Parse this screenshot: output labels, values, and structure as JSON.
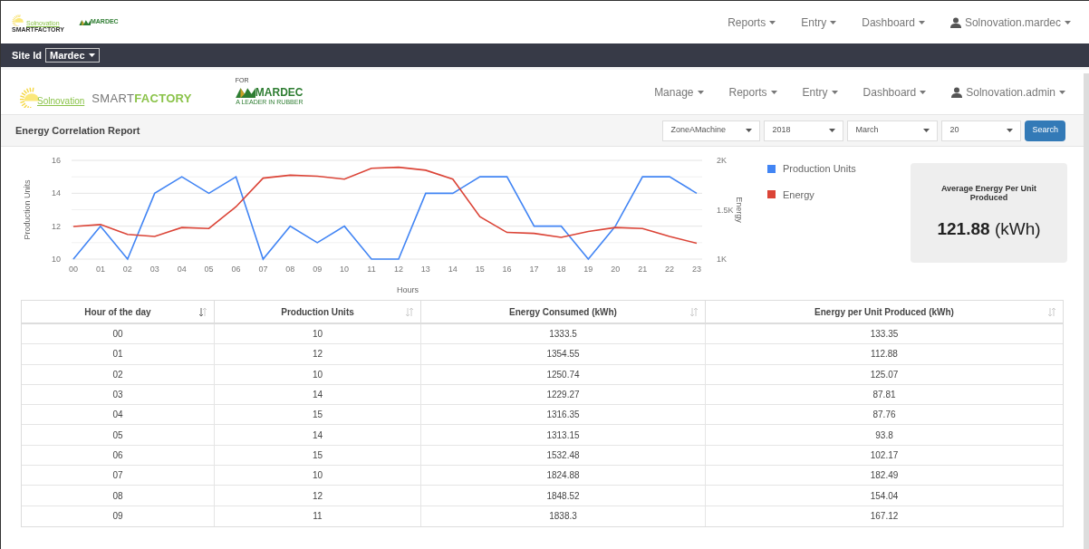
{
  "outer_header": {
    "logo": {
      "brand": "Solnovation",
      "product": "SMARTFACTORY"
    },
    "partner_logo": {
      "name": "MARDEC"
    },
    "nav": [
      {
        "label": "Reports"
      },
      {
        "label": "Entry"
      },
      {
        "label": "Dashboard"
      }
    ],
    "user": "Solnovation.mardec"
  },
  "site_bar": {
    "label": "Site Id",
    "value": "Mardec"
  },
  "app_header": {
    "logo": {
      "brand": "Solnovation",
      "product_a": "SMART",
      "product_b": "FACTORY"
    },
    "partner_logo": {
      "for": "FOR",
      "name": "MARDEC",
      "tagline": "A LEADER IN RUBBER"
    },
    "nav": [
      {
        "label": "Manage"
      },
      {
        "label": "Reports"
      },
      {
        "label": "Entry"
      },
      {
        "label": "Dashboard"
      }
    ],
    "user": "Solnovation.admin"
  },
  "report_bar": {
    "title": "Energy Correlation Report",
    "filters": [
      {
        "value": "ZoneAMachine"
      },
      {
        "value": "2018"
      },
      {
        "value": "March"
      },
      {
        "value": "20"
      }
    ],
    "button": "Search"
  },
  "chart": {
    "chart_data": {
      "type": "line",
      "legend": "right",
      "xlabel": "Hours",
      "ylabel": "Production Units",
      "y2label": "Energy",
      "categories": [
        "00",
        "01",
        "02",
        "03",
        "04",
        "05",
        "06",
        "07",
        "08",
        "09",
        "10",
        "11",
        "12",
        "13",
        "14",
        "15",
        "16",
        "17",
        "18",
        "19",
        "20",
        "21",
        "22",
        "23"
      ],
      "ylim": [
        10,
        16
      ],
      "yticks": [
        10,
        12,
        14,
        16
      ],
      "y2lim": [
        1000,
        2000
      ],
      "y2ticks": [
        {
          "value": 1000,
          "label": "1K"
        },
        {
          "value": 1500,
          "label": "1.5K"
        },
        {
          "value": 2000,
          "label": "2K"
        }
      ],
      "series": [
        {
          "name": "Production Units",
          "color": "#4285f4",
          "values": [
            10,
            12,
            10,
            14,
            15,
            14,
            15,
            10,
            12,
            11,
            12,
            10,
            10,
            14,
            14,
            15,
            15,
            12,
            12,
            10,
            12,
            15,
            15,
            14
          ]
        },
        {
          "name": "Energy",
          "color": "#db4437",
          "axis": "y2",
          "values": [
            1330,
            1350,
            1250,
            1230,
            1320,
            1310,
            1530,
            1820,
            1850,
            1840,
            1810,
            1920,
            1930,
            1900,
            1810,
            1430,
            1270,
            1260,
            1220,
            1280,
            1320,
            1310,
            1230,
            1160
          ]
        }
      ]
    }
  },
  "summary": {
    "title": "Average Energy Per Unit Produced",
    "value": "121.88",
    "unit": "(kWh)"
  },
  "table": {
    "columns": [
      {
        "label": "Hour of the day",
        "sorted": true
      },
      {
        "label": "Production Units",
        "sorted": false
      },
      {
        "label": "Energy Consumed (kWh)",
        "sorted": false
      },
      {
        "label": "Energy per Unit Produced (kWh)",
        "sorted": false
      }
    ],
    "rows": [
      [
        "00",
        "10",
        "1333.5",
        "133.35"
      ],
      [
        "01",
        "12",
        "1354.55",
        "112.88"
      ],
      [
        "02",
        "10",
        "1250.74",
        "125.07"
      ],
      [
        "03",
        "14",
        "1229.27",
        "87.81"
      ],
      [
        "04",
        "15",
        "1316.35",
        "87.76"
      ],
      [
        "05",
        "14",
        "1313.15",
        "93.8"
      ],
      [
        "06",
        "15",
        "1532.48",
        "102.17"
      ],
      [
        "07",
        "10",
        "1824.88",
        "182.49"
      ],
      [
        "08",
        "12",
        "1848.52",
        "154.04"
      ],
      [
        "09",
        "11",
        "1838.3",
        "167.12"
      ]
    ]
  }
}
